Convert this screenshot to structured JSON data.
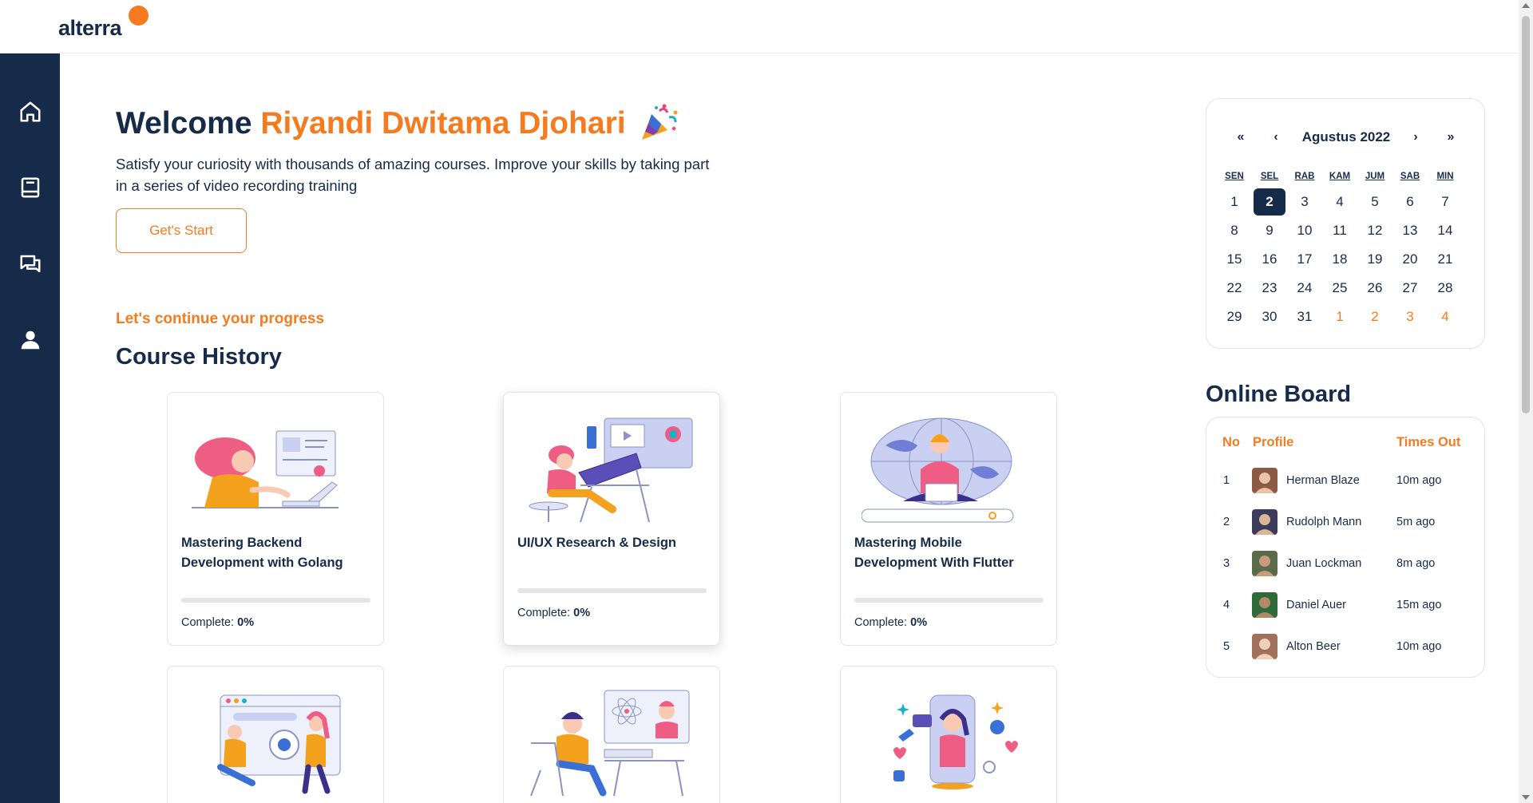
{
  "brand": {
    "logo_text": "alterra",
    "accent_color": "#f47b20",
    "primary_color": "#162b4a"
  },
  "sidebar": {
    "items": [
      {
        "icon": "home-icon",
        "label": "Home"
      },
      {
        "icon": "book-icon",
        "label": "Courses"
      },
      {
        "icon": "chat-icon",
        "label": "Discussion"
      },
      {
        "icon": "user-icon",
        "label": "Profile"
      }
    ]
  },
  "hero": {
    "welcome": "Welcome",
    "user_name": "Riyandi Dwitama Djohari",
    "subtitle": "Satisfy your curiosity with thousands of amazing courses. Improve your skills by taking part in a series of video recording training",
    "cta_label": "Get's Start"
  },
  "progress_hint": "Let's continue your progress",
  "course_history": {
    "title": "Course History",
    "complete_label": "Complete:",
    "courses": [
      {
        "title": "Mastering Backend Development with Golang",
        "progress": "0%"
      },
      {
        "title": "UI/UX Research & Design",
        "progress": "0%"
      },
      {
        "title": "Mastering Mobile Development With Flutter",
        "progress": "0%"
      },
      {
        "title": "",
        "progress": ""
      },
      {
        "title": "",
        "progress": ""
      },
      {
        "title": "",
        "progress": ""
      }
    ]
  },
  "calendar": {
    "prev_year": "«",
    "prev_month": "‹",
    "month_label": "Agustus 2022",
    "next_month": "›",
    "next_year": "»",
    "weekdays": [
      "SEN",
      "SEL",
      "RAB",
      "KAM",
      "JUM",
      "SAB",
      "MIN"
    ],
    "weeks": [
      [
        "1",
        "2",
        "3",
        "4",
        "5",
        "6",
        "7"
      ],
      [
        "8",
        "9",
        "10",
        "11",
        "12",
        "13",
        "14"
      ],
      [
        "15",
        "16",
        "17",
        "18",
        "19",
        "20",
        "21"
      ],
      [
        "22",
        "23",
        "24",
        "25",
        "26",
        "27",
        "28"
      ],
      [
        "29",
        "30",
        "31",
        "1",
        "2",
        "3",
        "4"
      ]
    ],
    "selected_day": "2",
    "next_month_days_from_index": 31
  },
  "online_board": {
    "title": "Online Board",
    "headers": {
      "no": "No",
      "profile": "Profile",
      "times_out": "Times Out"
    },
    "rows": [
      {
        "no": "1",
        "name": "Herman Blaze",
        "time": "10m ago"
      },
      {
        "no": "2",
        "name": "Rudolph Mann",
        "time": "5m ago"
      },
      {
        "no": "3",
        "name": "Juan Lockman",
        "time": "8m ago"
      },
      {
        "no": "4",
        "name": "Daniel Auer",
        "time": "15m ago"
      },
      {
        "no": "5",
        "name": "Alton Beer",
        "time": "10m ago"
      }
    ]
  }
}
